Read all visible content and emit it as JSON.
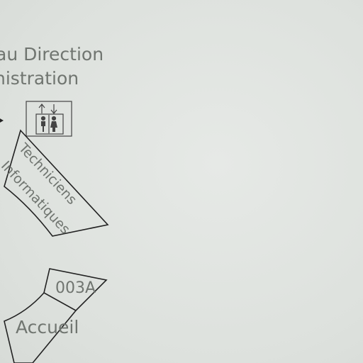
{
  "sign": {
    "title_line_1": "au Direction",
    "title_line_2": "nistration",
    "rooms": {
      "techniciens_line_1": "Techniciens",
      "techniciens_line_2": "Informatiques",
      "room_003a": "003A",
      "accueil": "Accueil"
    },
    "icons": {
      "direction_arrow": "arrow-right-icon",
      "elevator": "elevator-icon"
    },
    "colors": {
      "background": "#dfe3df",
      "ink": "#707570",
      "lines": "#222222"
    }
  }
}
